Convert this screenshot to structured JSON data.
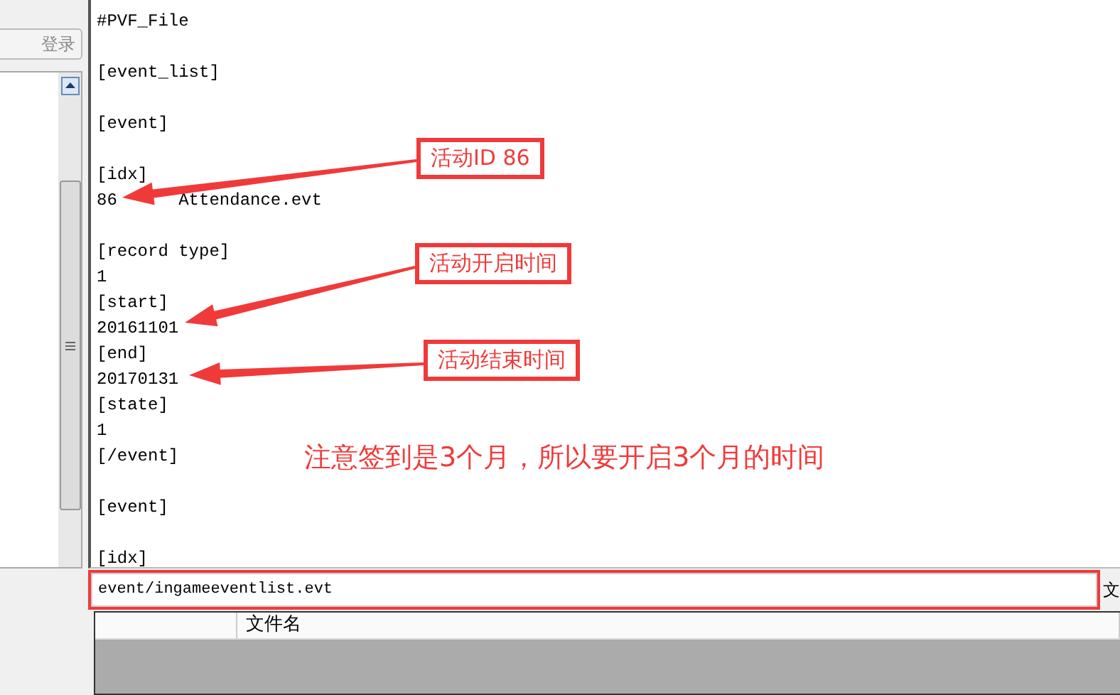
{
  "sidebar": {
    "login_button": "登录"
  },
  "editor": {
    "lines": [
      {
        "kind": "text",
        "text": "#PVF_File"
      },
      {
        "kind": "blank"
      },
      {
        "kind": "text",
        "text": "[event_list]"
      },
      {
        "kind": "blank"
      },
      {
        "kind": "text",
        "text": "[event]"
      },
      {
        "kind": "blank"
      },
      {
        "kind": "text",
        "text": "[idx]"
      },
      {
        "kind": "text",
        "text": "86\tAttendance.evt"
      },
      {
        "kind": "blank"
      },
      {
        "kind": "text",
        "text": "[record type]"
      },
      {
        "kind": "text",
        "text": "1"
      },
      {
        "kind": "text",
        "text": "[start]"
      },
      {
        "kind": "text",
        "text": "20161101"
      },
      {
        "kind": "text",
        "text": "[end]"
      },
      {
        "kind": "text",
        "text": "20170131"
      },
      {
        "kind": "text",
        "text": "[state]"
      },
      {
        "kind": "text",
        "text": "1"
      },
      {
        "kind": "text",
        "text": "[/event]"
      },
      {
        "kind": "blank"
      },
      {
        "kind": "text",
        "text": "[event]"
      },
      {
        "kind": "blank"
      },
      {
        "kind": "text",
        "text": "[idx]"
      }
    ]
  },
  "annotations": [
    {
      "label": "活动ID 86"
    },
    {
      "label": "活动开启时间"
    },
    {
      "label": "活动结束时间"
    }
  ],
  "note": "注意签到是3个月，所以要开启3个月的时间",
  "path_field": {
    "value": "event/ingameeventlist.evt",
    "side_text": "文"
  },
  "file_table": {
    "columns": [
      "",
      "文件名"
    ]
  }
}
